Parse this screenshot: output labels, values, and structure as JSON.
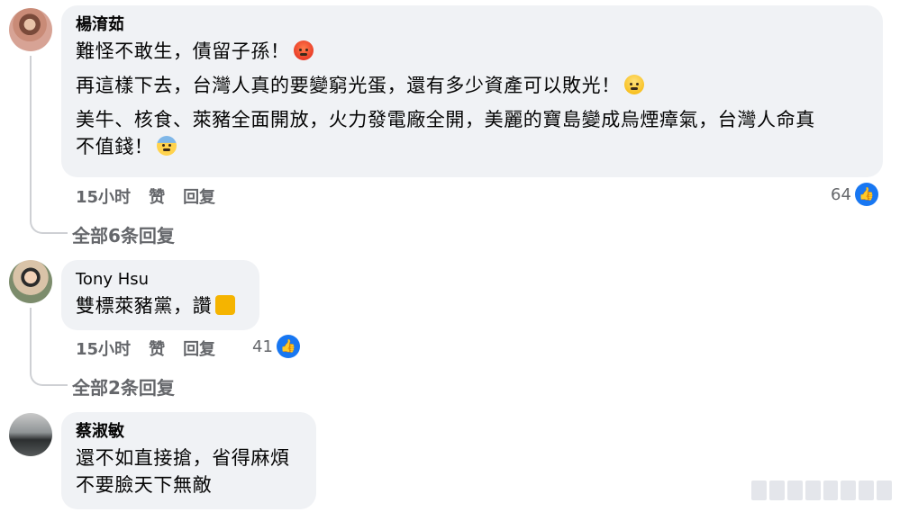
{
  "comments": [
    {
      "author": "楊淯茹",
      "lines": [
        "難怪不敢生，債留子孫！",
        "再這樣下去，台灣人真的要變窮光蛋，還有多少資產可以敗光！",
        "美牛、核食、萊豬全面開放，火力發電廠全開，美麗的寶島變成烏煙瘴氣，台灣人命真",
        "不值錢！"
      ],
      "emojis": [
        "angry-face-icon",
        "crying-face-icon",
        "anxious-face-icon"
      ],
      "time": "15小时",
      "like_action": "赞",
      "reply_action": "回复",
      "like_count": "64",
      "view_replies": "全部6条回复"
    },
    {
      "author": "Tony Hsu",
      "lines": [
        "雙標萊豬黨，讚"
      ],
      "emojis": [
        "thumbs-up-icon"
      ],
      "time": "15小时",
      "like_action": "赞",
      "reply_action": "回复",
      "like_count": "41",
      "view_replies": "全部2条回复"
    },
    {
      "author": "蔡淑敏",
      "lines": [
        "還不如直接搶，省得麻煩",
        "不要臉天下無敵"
      ]
    }
  ],
  "colors": {
    "bubble": "#f0f2f5",
    "meta_text": "#65676b",
    "like_blue": "#1877f2"
  }
}
